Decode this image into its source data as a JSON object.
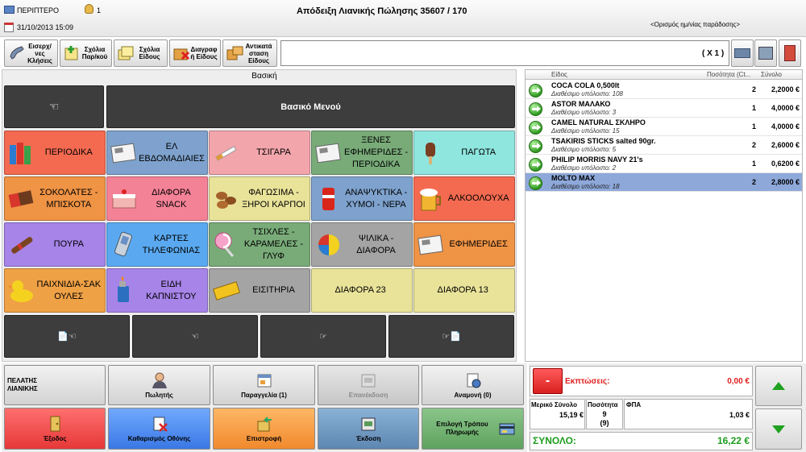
{
  "header": {
    "store": "ΠΕΡΙΠΤΕΡΟ",
    "user": "1",
    "datetime": "31/10/2013 15:09",
    "title": "Απόδειξη Λιανικής Πώλησης  35607 / 170",
    "delivery": "<Ορισμός ημ/νίας παράδοσης>"
  },
  "toolbar": {
    "items": [
      {
        "label": "Εισερχ/νες Κλήσεις"
      },
      {
        "label": "Σχόλια Παρ/κού"
      },
      {
        "label": "Σχόλια Είδους"
      },
      {
        "label": "Διαγραφ ή Είδους"
      },
      {
        "label": "Αντικατά σταση Είδους"
      }
    ],
    "multiplier": "( X 1 )"
  },
  "panel": {
    "title": "Βασική",
    "main_menu": "Βασικό Μενού"
  },
  "categories": [
    {
      "label": "ΠΕΡΙΟΔΙΚΑ",
      "color": "#f46a50",
      "icon": "books-icon"
    },
    {
      "label": "ΕΛ ΕΒΔΟΜΑΔΙΑΙΕΣ",
      "color": "#7ea2cd",
      "icon": "newspaper-icon"
    },
    {
      "label": "ΤΣΙΓΑΡΑ",
      "color": "#f2a6ac",
      "icon": "cigarette-icon"
    },
    {
      "label": "ΞΕΝΕΣ ΕΦΗΜΕΡΙΔΕΣ - ΠΕΡΙΟΔΙΚΑ",
      "color": "#79ab79",
      "icon": "newspaper-icon"
    },
    {
      "label": "ΠΑΓΩΤΑ",
      "color": "#8fe6df",
      "icon": "ice-cream-icon"
    },
    {
      "label": "ΣΟΚΟΛΑΤΕΣ - ΜΠΙΣΚΟΤΑ",
      "color": "#ef9345",
      "icon": "chocolate-icon"
    },
    {
      "label": "ΔΙΑΦΟΡΑ SNACK",
      "color": "#f48296",
      "icon": "cake-icon"
    },
    {
      "label": "ΦΑΓΩΣΙΜΑ - ΞΗΡΟΙ ΚΑΡΠΟΙ",
      "color": "#e9e39a",
      "icon": "nuts-icon"
    },
    {
      "label": "ΑΝΑΨΥΚΤΙΚΑ - ΧΥΜΟΙ - ΝΕΡΑ",
      "color": "#7ea2cd",
      "icon": "soda-can-icon"
    },
    {
      "label": "ΑΛΚΟΟΛΟΥΧΑ",
      "color": "#f46a50",
      "icon": "beer-icon"
    },
    {
      "label": "ΠΟΥΡΑ",
      "color": "#a684e8",
      "icon": "cigar-icon"
    },
    {
      "label": "ΚΑΡΤΕΣ ΤΗΛΕΦΩΝΙΑΣ",
      "color": "#5aa9f0",
      "icon": "phone-icon"
    },
    {
      "label": "ΤΣΙΧΛΕΣ - ΚΑΡΑΜΕΛΕΣ - ΓΛΥΦ",
      "color": "#79ab79",
      "icon": "lollipop-icon"
    },
    {
      "label": "ΨΙΛΙΚΑ - ΔΙΑΦΟΡΑ",
      "color": "#a4a4a4",
      "icon": "ball-icon"
    },
    {
      "label": "ΕΦΗΜΕΡΙΔΕΣ",
      "color": "#ef9345",
      "icon": "newspaper-icon"
    },
    {
      "label": "ΠΑΙΧΝΙΔΙΑ-ΣΑΚ ΟΥΛΕΣ",
      "color": "#efa146",
      "icon": "duck-icon"
    },
    {
      "label": "ΕΙΔΗ ΚΑΠΝΙΣΤΟΥ",
      "color": "#a684e8",
      "icon": "lighter-icon"
    },
    {
      "label": "ΕΙΣΙΤΗΡΙΑ",
      "color": "#a4a4a4",
      "icon": "ticket-icon"
    },
    {
      "label": "ΔΙΑΦΟΡΑ 23",
      "color": "#e9e39a",
      "icon": ""
    },
    {
      "label": "ΔΙΑΦΟΡΑ 13",
      "color": "#e9e39a",
      "icon": ""
    }
  ],
  "nav": {
    "first_glyph": "📄☜",
    "prev_glyph": "☜",
    "next_glyph": "☞",
    "last_glyph": "☞📄"
  },
  "receipt": {
    "columns": [
      "Είδος",
      "Ποσότητα (Ct...",
      "Σύνολο"
    ],
    "rows": [
      {
        "name": "COCA COLA 0,500lt",
        "stock": "Διαθέσιμο υπόλοιπο: 108",
        "qty": "2",
        "total": "2,2000 €"
      },
      {
        "name": "ASTOR ΜΑΛΑΚΟ",
        "stock": "Διαθέσιμο υπόλοιπο: 3",
        "qty": "1",
        "total": "4,0000 €"
      },
      {
        "name": "CAMEL NATURAL ΣΚΛΗΡΟ",
        "stock": "Διαθέσιμο υπόλοιπο: 15",
        "qty": "1",
        "total": "4,0000 €"
      },
      {
        "name": "TSAKIRIS STICKS salted 90gr.",
        "stock": "Διαθέσιμο υπόλοιπο: 5",
        "qty": "2",
        "total": "2,6000 €"
      },
      {
        "name": "PHILIP MORRIS NAVY 21's",
        "stock": "Διαθέσιμο υπόλοιπο: 2",
        "qty": "1",
        "total": "0,6200 €"
      },
      {
        "name": "MOLTO MAX",
        "stock": "Διαθέσιμο υπόλοιπο: 18",
        "qty": "2",
        "total": "2,8000 €"
      }
    ]
  },
  "actions": {
    "customer": "ΠΕΛΑΤΗΣ ΛΙΑΝΙΚΗΣ",
    "seller": "Πωλητής",
    "order": "Παραγγελία (1)",
    "reissue": "Επανέκδοση",
    "waiting": "Αναμονή (0)",
    "exit": "Έξοδος",
    "clear": "Καθαρισμός Οθόνης",
    "return": "Επιστροφή",
    "issue": "Έκδοση",
    "payment": "Επιλογή Τρόπου Πληρωμής"
  },
  "totals": {
    "minus": "-",
    "discounts_label": "Εκπτώσεις:",
    "discounts_value": "0,00 €",
    "subtotal_label": "Μερικό Σύνολο",
    "subtotal_value": "15,19 €",
    "qty_label": "Ποσότητα",
    "qty_value": "9",
    "qty_value2": "(9)",
    "vat_label": "ΦΠΑ",
    "vat_value": "1,03 €",
    "total_label": "ΣΥΝΟΛΟ:",
    "total_value": "16,22 €"
  }
}
